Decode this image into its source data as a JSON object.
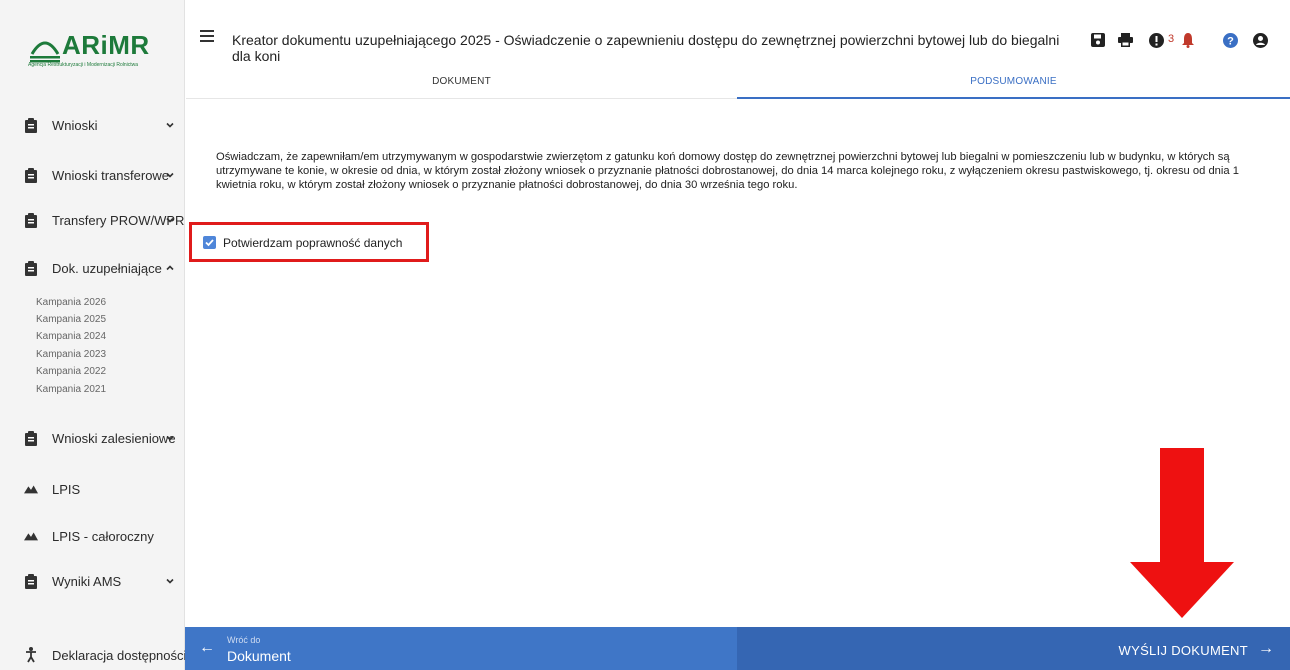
{
  "logo": {
    "name": "ARiMR",
    "subtitle": "Agencja Restrukturyzacji i Modernizacji Rolnictwa",
    "color": "#1d7a3a"
  },
  "sidebar": {
    "items": [
      {
        "label": "Wnioski",
        "icon": "clipboard-icon",
        "expanded": false
      },
      {
        "label": "Wnioski transferowe",
        "icon": "clipboard-icon",
        "expanded": false
      },
      {
        "label": "Transfery PROW/WPR",
        "icon": "clipboard-icon",
        "expanded": false
      },
      {
        "label": "Dok. uzupełniające",
        "icon": "clipboard-icon",
        "expanded": true
      },
      {
        "label": "Wnioski zalesieniowe",
        "icon": "clipboard-icon",
        "expanded": false
      },
      {
        "label": "LPIS",
        "icon": "mountain-icon"
      },
      {
        "label": "LPIS - całoroczny",
        "icon": "mountain-icon"
      },
      {
        "label": "Wyniki AMS",
        "icon": "clipboard-icon",
        "expanded": false
      },
      {
        "label": "Deklaracja dostępności",
        "icon": "accessibility-icon"
      }
    ],
    "campaigns": [
      "Kampania 2026",
      "Kampania 2025",
      "Kampania 2024",
      "Kampania 2023",
      "Kampania 2022",
      "Kampania 2021"
    ]
  },
  "header": {
    "title": "Kreator dokumentu uzupełniającego 2025 - Oświadczenie o zapewnieniu dostępu do zewnętrznej powierzchni bytowej lub do biegalni dla koni",
    "notification_count": "3",
    "icons": [
      "save-icon",
      "print-icon",
      "alert-icon",
      "bell-icon",
      "help-icon",
      "user-icon"
    ]
  },
  "tabs": [
    {
      "label": "DOKUMENT",
      "active": false
    },
    {
      "label": "PODSUMOWANIE",
      "active": true
    }
  ],
  "content": {
    "statement": "Oświadczam, że zapewniłam/em utrzymywanym w gospodarstwie zwierzętom z gatunku koń domowy dostęp do zewnętrznej powierzchni bytowej lub biegalni w pomieszczeniu lub w budynku, w których są utrzymywane te konie, w okresie od dnia, w którym został złożony wniosek o przyznanie płatności dobrostanowej, do dnia 14 marca kolejnego roku, z wyłączeniem okresu pastwiskowego, tj. okresu od dnia 1 kwietnia roku, w którym został złożony wniosek o przyznanie płatności dobrostanowej, do dnia 30 września tego roku.",
    "confirm_label": "Potwierdzam poprawność danych",
    "confirm_checked": true
  },
  "footer": {
    "back_small": "Wróć do",
    "back_label": "Dokument",
    "send_label": "WYŚLIJ DOKUMENT"
  },
  "colors": {
    "accent": "#3a6fc4",
    "highlight": "#e01b1b",
    "footer_left": "#3f76c7",
    "footer_right": "#3566b3"
  }
}
